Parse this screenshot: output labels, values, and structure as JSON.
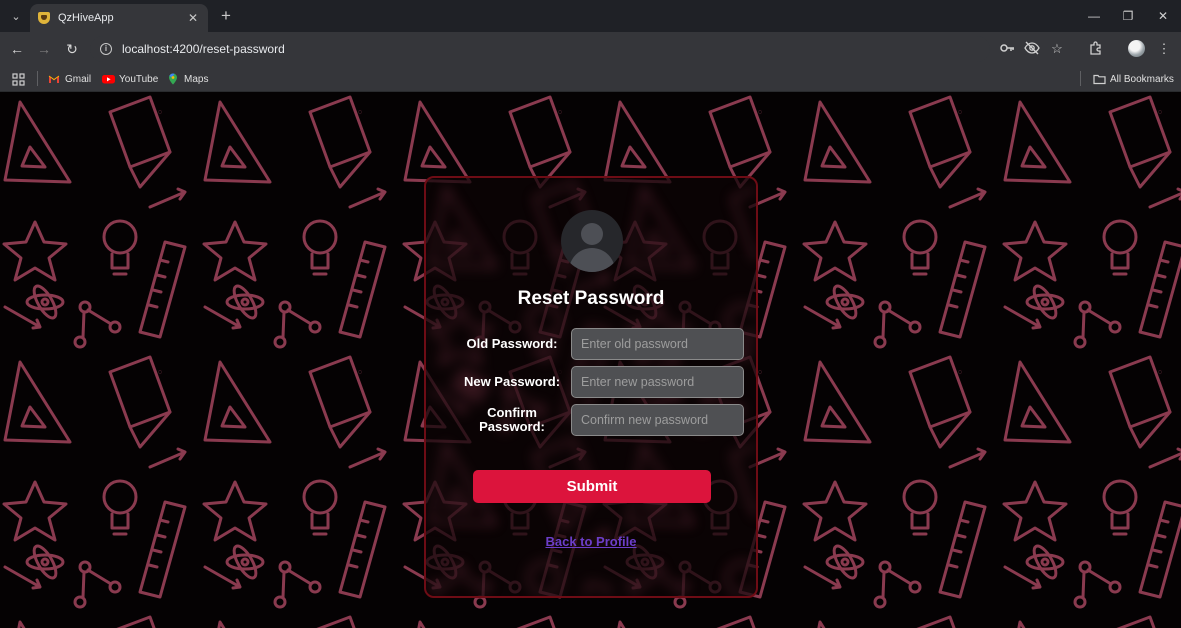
{
  "browser": {
    "tab_title": "QzHiveApp",
    "new_tab_symbol": "+",
    "url": "localhost:4200/reset-password",
    "bookmarks": [
      {
        "label": "Gmail",
        "icon": "gmail-icon"
      },
      {
        "label": "YouTube",
        "icon": "youtube-icon"
      },
      {
        "label": "Maps",
        "icon": "maps-icon"
      }
    ],
    "all_bookmarks_label": "All Bookmarks"
  },
  "colors": {
    "accent": "#dc143c",
    "card_border": "#6e0c15",
    "doodle": "#8a3a4f",
    "link": "#6c3ec9"
  },
  "form": {
    "title": "Reset Password",
    "old_password": {
      "label": "Old Password:",
      "placeholder": "Enter old password",
      "value": ""
    },
    "new_password": {
      "label": "New Password:",
      "placeholder": "Enter new password",
      "value": ""
    },
    "confirm_password": {
      "label_line1": "Confirm",
      "label_line2": "Password:",
      "placeholder": "Confirm new password",
      "value": ""
    },
    "submit_label": "Submit",
    "back_link": "Back to Profile"
  }
}
